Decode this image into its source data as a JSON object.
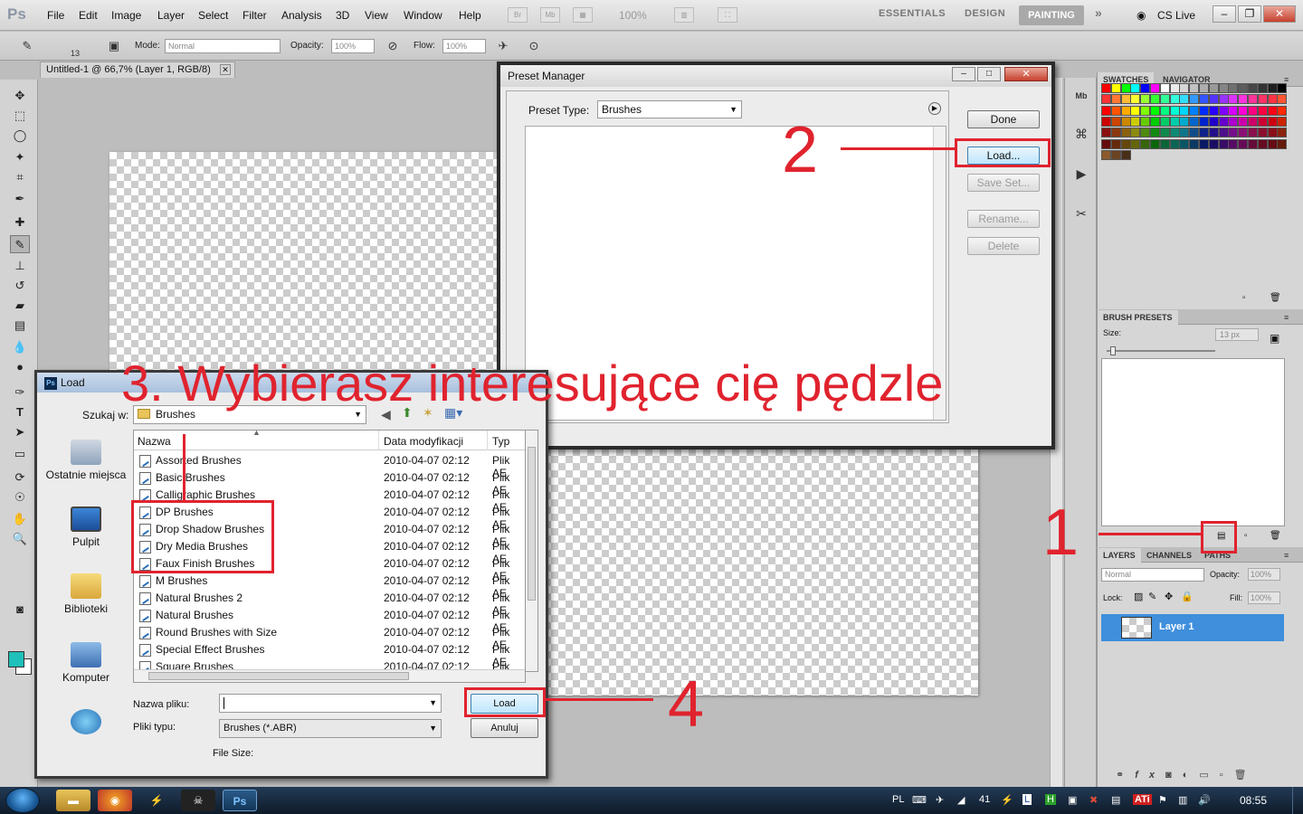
{
  "app": {
    "logo": "Ps",
    "menu": [
      "File",
      "Edit",
      "Image",
      "Layer",
      "Select",
      "Filter",
      "Analysis",
      "3D",
      "View",
      "Window",
      "Help"
    ],
    "zoom": "100%",
    "workspaces": [
      "ESSENTIALS",
      "DESIGN",
      "PAINTING"
    ],
    "active_workspace": "PAINTING",
    "cs_live": "CS Live"
  },
  "options": {
    "brush_size": "13",
    "mode_label": "Mode:",
    "mode_value": "Normal",
    "opacity_label": "Opacity:",
    "opacity_value": "100%",
    "flow_label": "Flow:",
    "flow_value": "100%"
  },
  "document": {
    "tab_title": "Untitled-1 @ 66,7% (Layer 1, RGB/8)"
  },
  "panels": {
    "swatches_tab": "SWATCHES",
    "navigator_tab": "NAVIGATOR",
    "brush_presets_tab": "BRUSH PRESETS",
    "size_label": "Size:",
    "size_value": "13 px",
    "layers_tab": "LAYERS",
    "channels_tab": "CHANNELS",
    "paths_tab": "PATHS",
    "blend_mode": "Normal",
    "opacity_label": "Opacity:",
    "opacity_value": "100%",
    "lock_label": "Lock:",
    "fill_label": "Fill:",
    "fill_value": "100%",
    "layer_name": "Layer 1"
  },
  "preset_manager": {
    "title": "Preset Manager",
    "preset_type_label": "Preset Type:",
    "preset_type_value": "Brushes",
    "done": "Done",
    "load": "Load...",
    "save_set": "Save Set...",
    "rename": "Rename...",
    "delete": "Delete"
  },
  "load_dialog": {
    "title": "Load",
    "look_in_label": "Szukaj w:",
    "look_in_value": "Brushes",
    "columns": [
      "Nazwa",
      "Data modyfikacji",
      "Typ"
    ],
    "places": [
      "Ostatnie miejsca",
      "Pulpit",
      "Biblioteki",
      "Komputer"
    ],
    "files": [
      {
        "name": "Assorted Brushes",
        "date": "2010-04-07 02:12",
        "type": "Plik AE"
      },
      {
        "name": "Basic Brushes",
        "date": "2010-04-07 02:12",
        "type": "Plik AE"
      },
      {
        "name": "Calligraphic Brushes",
        "date": "2010-04-07 02:12",
        "type": "Plik AE"
      },
      {
        "name": "DP Brushes",
        "date": "2010-04-07 02:12",
        "type": "Plik AE"
      },
      {
        "name": "Drop Shadow Brushes",
        "date": "2010-04-07 02:12",
        "type": "Plik AE"
      },
      {
        "name": "Dry Media Brushes",
        "date": "2010-04-07 02:12",
        "type": "Plik AE"
      },
      {
        "name": "Faux Finish Brushes",
        "date": "2010-04-07 02:12",
        "type": "Plik AE"
      },
      {
        "name": "M Brushes",
        "date": "2010-04-07 02:12",
        "type": "Plik AE"
      },
      {
        "name": "Natural Brushes 2",
        "date": "2010-04-07 02:12",
        "type": "Plik AE"
      },
      {
        "name": "Natural Brushes",
        "date": "2010-04-07 02:12",
        "type": "Plik AE"
      },
      {
        "name": "Round Brushes with Size",
        "date": "2010-04-07 02:12",
        "type": "Plik AE"
      },
      {
        "name": "Special Effect Brushes",
        "date": "2010-04-07 02:12",
        "type": "Plik AE"
      },
      {
        "name": "Square Brushes",
        "date": "2010-04-07 02:12",
        "type": "Plik AE"
      }
    ],
    "filename_label": "Nazwa pliku:",
    "filename_value": "",
    "filetype_label": "Pliki typu:",
    "filetype_value": "Brushes (*.ABR)",
    "load_button": "Load",
    "cancel_button": "Anuluj",
    "file_size_label": "File Size:"
  },
  "annotations": {
    "step1": "1",
    "step2": "2",
    "step3": "3. Wybierasz interesujące cię pędzle",
    "step4": "4",
    "color": "#e0232e"
  },
  "taskbar": {
    "lang": "PL",
    "clock": "08:55"
  },
  "colors": {
    "foreground": "#1fc0b9",
    "background": "#ffffff",
    "layer_selected": "#3f8fdd"
  }
}
